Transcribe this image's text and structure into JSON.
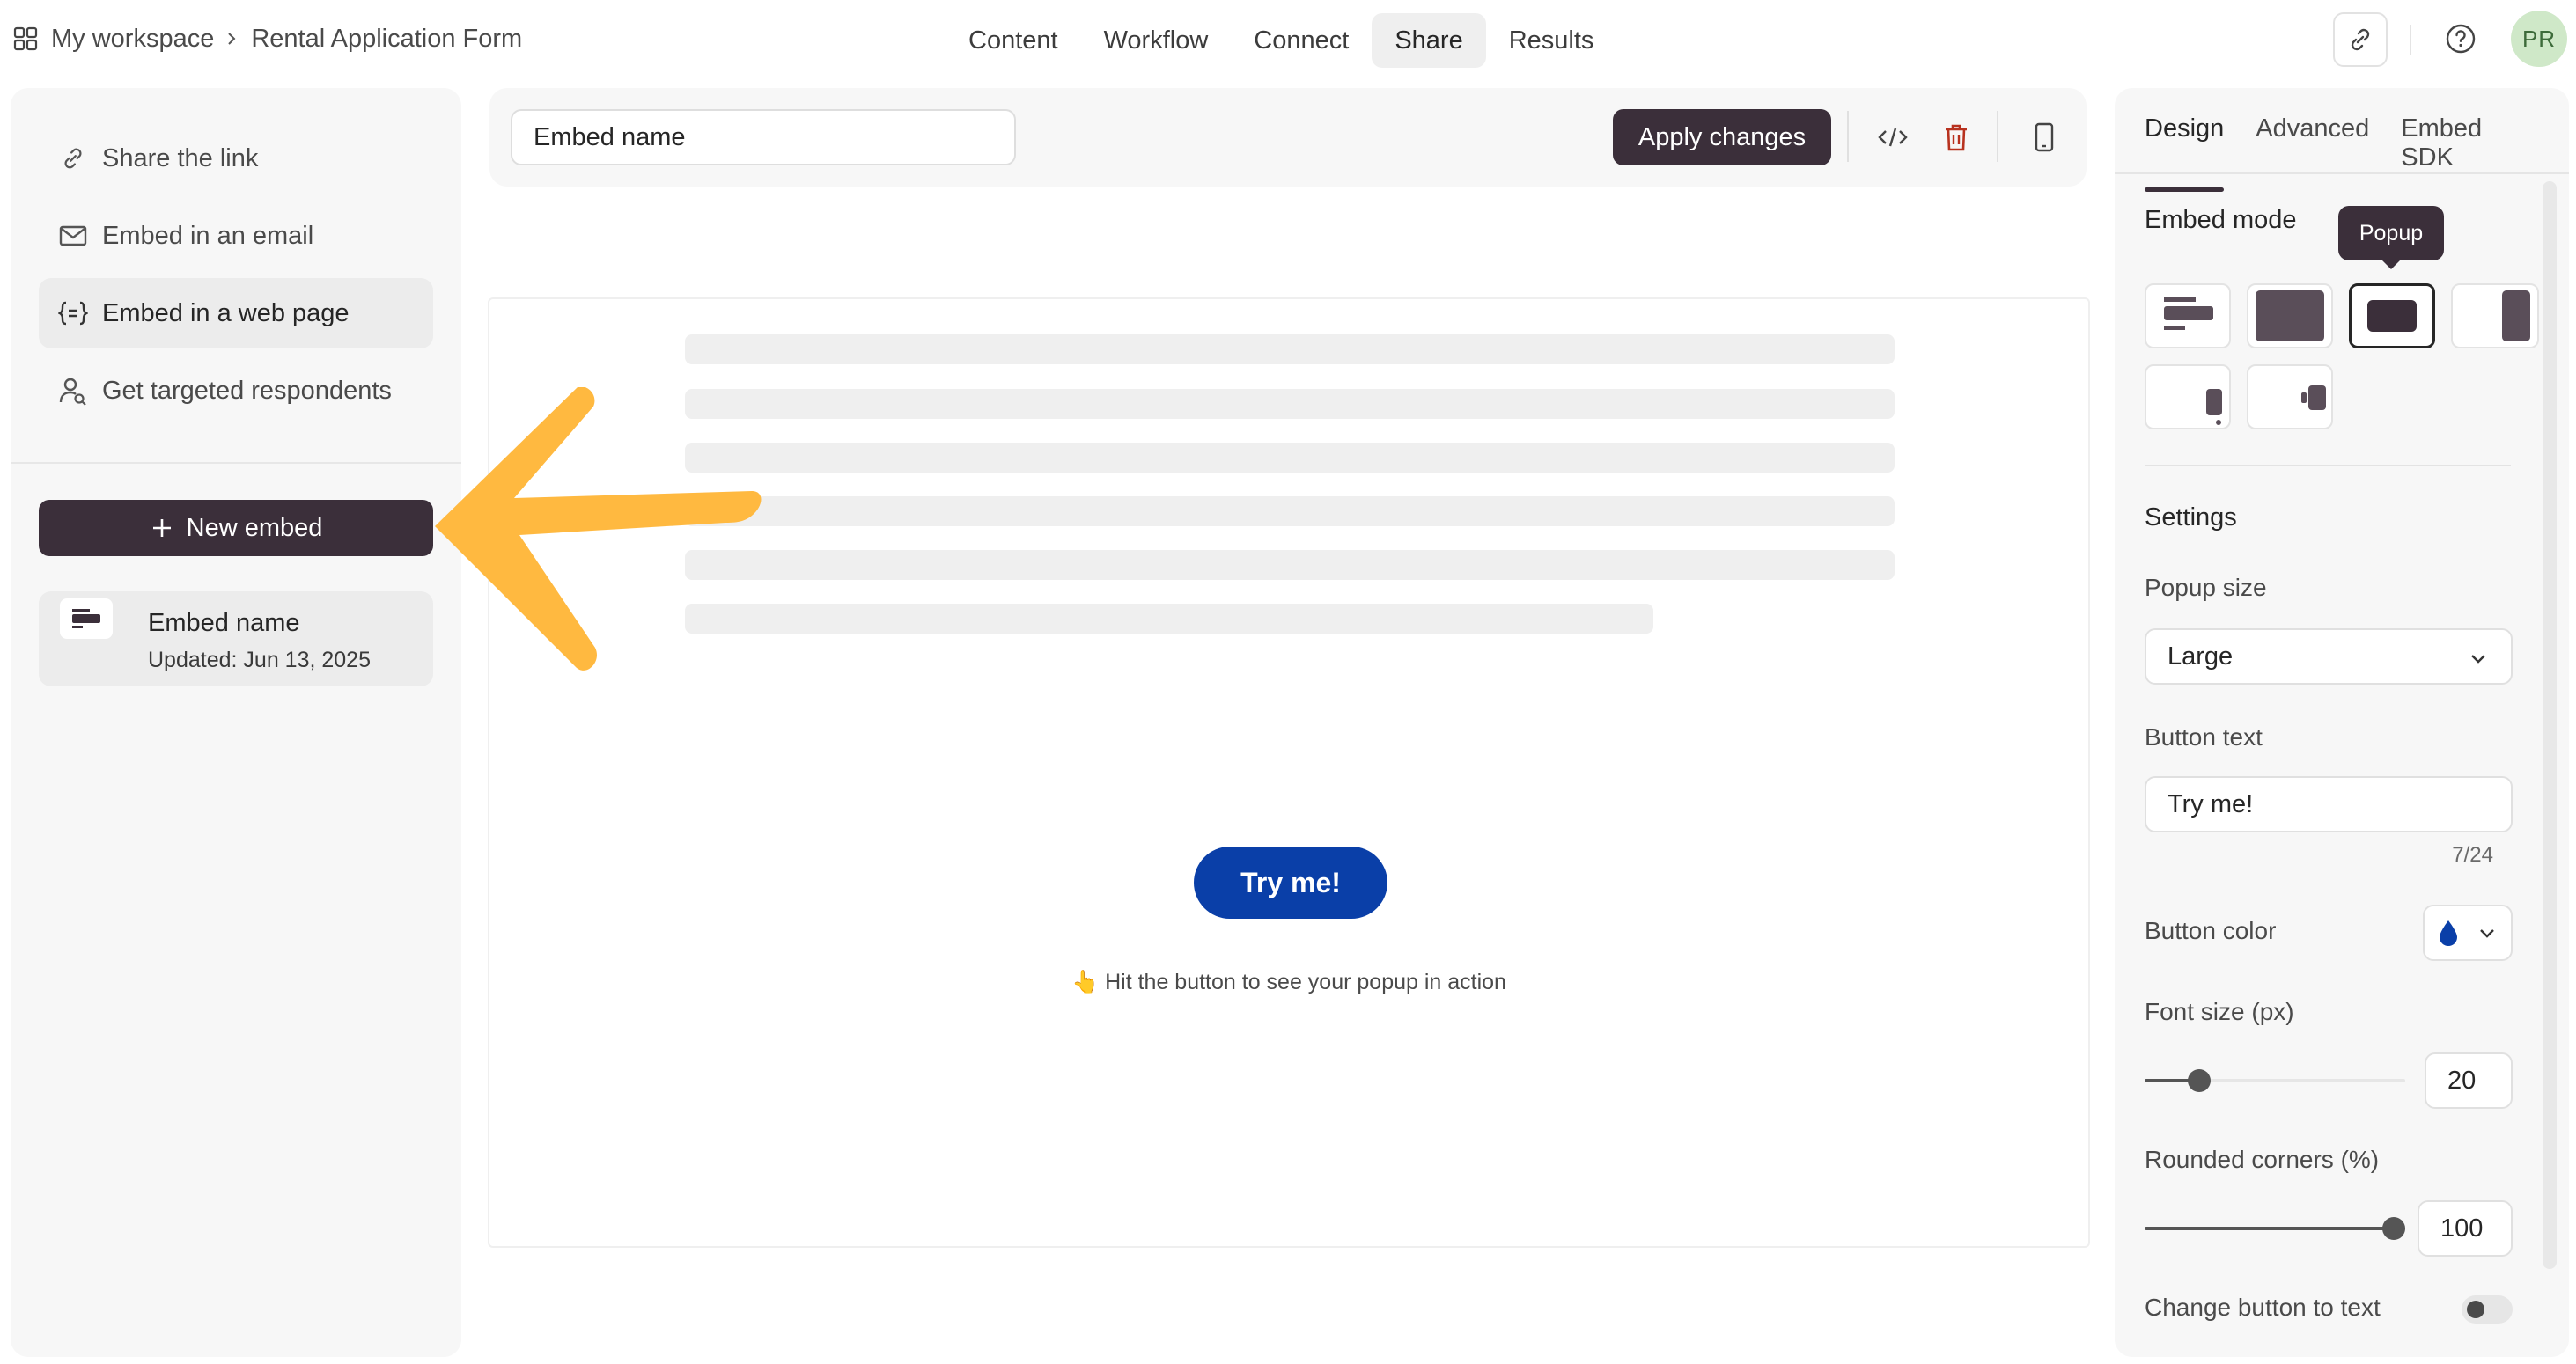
{
  "breadcrumb": {
    "workspace": "My workspace",
    "form": "Rental Application Form"
  },
  "nav": [
    "Content",
    "Workflow",
    "Connect",
    "Share",
    "Results"
  ],
  "nav_active": "Share",
  "avatar": "PR",
  "share_options": [
    {
      "label": "Share the link",
      "icon": "link-icon"
    },
    {
      "label": "Embed in an email",
      "icon": "mail-icon"
    },
    {
      "label": "Embed in a web page",
      "icon": "code-braces-icon"
    },
    {
      "label": "Get targeted respondents",
      "icon": "user-search-icon"
    }
  ],
  "share_active": "Embed in a web page",
  "new_embed_label": "New embed",
  "embed_card": {
    "name": "Embed name",
    "updated": "Updated: Jun 13, 2025"
  },
  "toolbar": {
    "embed_name_value": "Embed name",
    "apply_label": "Apply changes"
  },
  "preview": {
    "button_label": "Try me!",
    "hint": "👆 Hit the button to see your popup in action",
    "button_color": "#0a3fa8"
  },
  "accent_color": "#ffb940",
  "right_panel": {
    "tabs": [
      "Design",
      "Advanced",
      "Embed SDK"
    ],
    "active_tab": "Design",
    "embed_mode_label": "Embed mode",
    "tooltip": "Popup",
    "settings_label": "Settings",
    "popup_size_label": "Popup size",
    "popup_size_value": "Large",
    "button_text_label": "Button text",
    "button_text_value": "Try me!",
    "char_count": "7/24",
    "button_color_label": "Button color",
    "font_size_label": "Font size (px)",
    "font_size_value": "20",
    "font_size_level": 0.18,
    "rounded_label": "Rounded corners (%)",
    "rounded_value": "100",
    "rounded_level": 1.0,
    "change_to_text_label": "Change button to text",
    "change_to_text_on": false
  }
}
